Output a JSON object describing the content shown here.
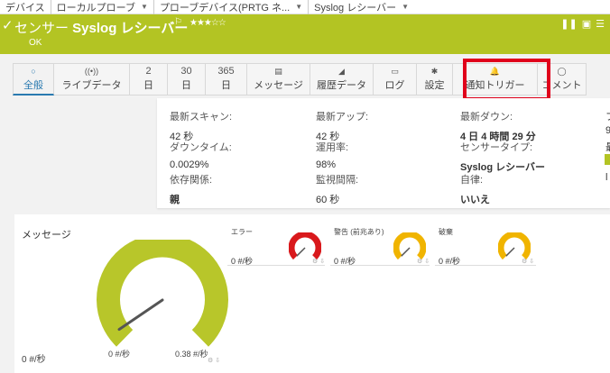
{
  "breadcrumb": [
    {
      "label": "デバイス",
      "dropdown": false
    },
    {
      "label": "ローカルプローブ",
      "dropdown": true
    },
    {
      "label": "プローブデバイス(PRTG ネ...",
      "dropdown": true
    },
    {
      "label": "Syslog レシーバー",
      "dropdown": true
    }
  ],
  "header": {
    "title_prefix": "センサー ",
    "title_name": "Syslog レシーバー",
    "stars": "★★★☆☆",
    "status": "OK",
    "colors": {
      "accent": "#b3c423"
    }
  },
  "tabs": [
    {
      "label": "全般",
      "icon": "○",
      "icon_name": "overview-icon",
      "active": true
    },
    {
      "label": "ライブデータ",
      "icon": "((•))",
      "icon_name": "live-data-icon",
      "active": false
    },
    {
      "label": "日",
      "icon": "2",
      "icon_name": "",
      "active": false
    },
    {
      "label": "日",
      "icon": "30",
      "icon_name": "",
      "active": false
    },
    {
      "label": "日",
      "icon": "365",
      "icon_name": "",
      "active": false
    },
    {
      "label": "メッセージ",
      "icon": "▤",
      "icon_name": "messages-icon",
      "active": false
    },
    {
      "label": "履歴データ",
      "icon": "◢",
      "icon_name": "historic-data-icon",
      "active": false
    },
    {
      "label": "ログ",
      "icon": "▭",
      "icon_name": "log-icon",
      "active": false
    },
    {
      "label": "設定",
      "icon": "✱",
      "icon_name": "settings-icon",
      "active": false
    },
    {
      "label": "通知トリガー",
      "icon": "🔔",
      "icon_name": "bell-icon",
      "active": false
    },
    {
      "label": "コメント",
      "icon": "◯",
      "icon_name": "comment-icon",
      "active": false
    }
  ],
  "info": {
    "last_scan": {
      "label": "最新スキャン:",
      "value": "42 秒"
    },
    "last_up": {
      "label": "最新アップ:",
      "value": "42 秒"
    },
    "last_down": {
      "label": "最新ダウン:",
      "value": "4 日 4 時間 29 分"
    },
    "downtime": {
      "label": "ダウンタイム:",
      "value": "0.0029%"
    },
    "uptime": {
      "label": "運用率:",
      "value": "98%"
    },
    "sensor_type": {
      "label": "センサータイプ:",
      "value": "Syslog レシーバー"
    },
    "dependency": {
      "label": "依存関係:",
      "value": "親"
    },
    "interval": {
      "label": "監視間隔:",
      "value": "60 秒"
    },
    "autonomy": {
      "label": "自律:",
      "value": "いいえ"
    },
    "cutoff": {
      "c1": "フ",
      "c2": "9",
      "c3": "最",
      "c4": "l"
    }
  },
  "messages": {
    "title": "メッセージ",
    "big_gauge": {
      "current": "0 #/秒",
      "min": "0 #/秒",
      "max": "0.38 #/秒",
      "fraction": 0.04
    },
    "small": [
      {
        "title": "エラー",
        "value": "0 #/秒",
        "color": "#d9191c"
      },
      {
        "title": "警告 (前兆あり)",
        "value": "0 #/秒",
        "color": "#f0b400"
      },
      {
        "title": "破棄",
        "value": "0 #/秒",
        "color": "#f0b400"
      }
    ]
  }
}
